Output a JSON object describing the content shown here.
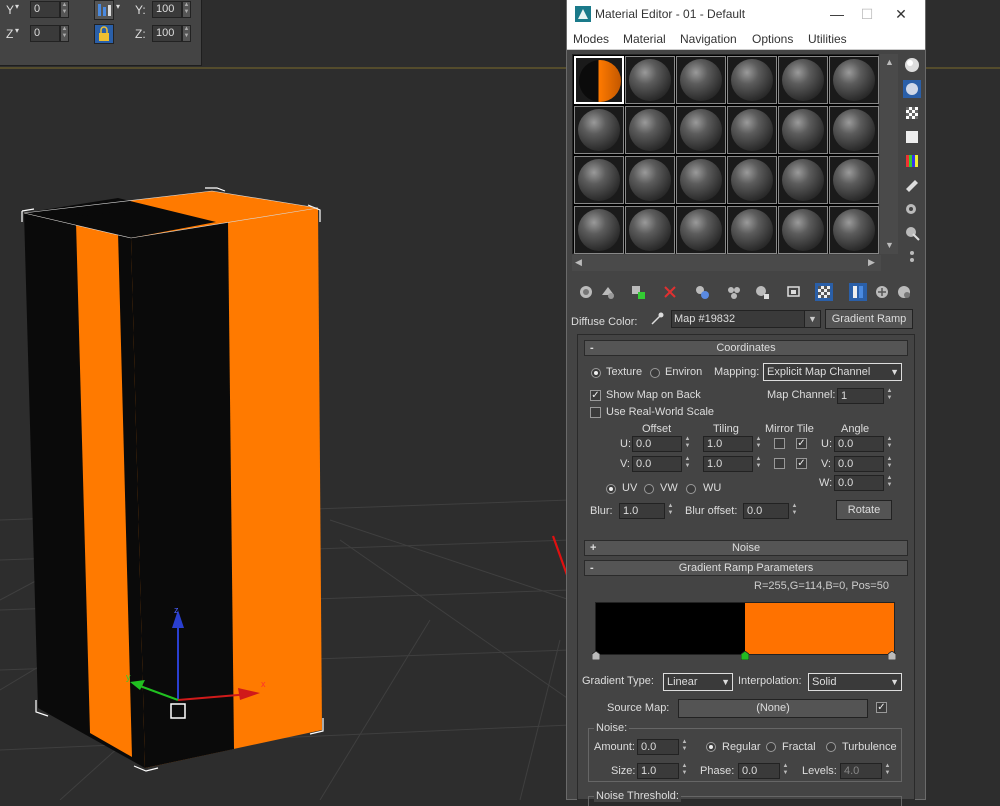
{
  "transform_bar": {
    "y_label": "Y",
    "y_value": "0",
    "z_label": "Z",
    "z_value": "0",
    "scale_y_label": "Y:",
    "scale_y_value": "100",
    "scale_z_label": "Z:",
    "scale_z_value": "100"
  },
  "window": {
    "title": "Material Editor - 01 - Default",
    "icon": "3ds-max-icon",
    "minimize_symbol": "—",
    "maximize_symbol": "☐",
    "close_symbol": "✕"
  },
  "menu": {
    "modes": "Modes",
    "material": "Material",
    "navigation": "Navigation",
    "options": "Options",
    "utilities": "Utilities"
  },
  "slots": {
    "rows": 4,
    "columns": 6,
    "selected_index": 0
  },
  "diffuse": {
    "label": "Diffuse Color:",
    "map_name": "Map #19832",
    "map_type": "Gradient Ramp"
  },
  "coordinates": {
    "header": "Coordinates",
    "collapse_symbol": "-",
    "texture_label": "Texture",
    "environ_label": "Environ",
    "mapping_label": "Mapping:",
    "mapping_value": "Explicit Map Channel",
    "show_map_on_back": "Show Map on Back",
    "map_channel_label": "Map Channel:",
    "map_channel_value": "1",
    "use_real_world": "Use Real-World Scale",
    "offset_label": "Offset",
    "tiling_label": "Tiling",
    "mirror_tile_label": "Mirror Tile",
    "angle_label": "Angle",
    "u_label": "U:",
    "v_label": "V:",
    "w_label": "W:",
    "u_offset": "0.0",
    "v_offset": "0.0",
    "u_tiling": "1.0",
    "v_tiling": "1.0",
    "u_angle": "0.0",
    "v_angle": "0.0",
    "w_angle": "0.0",
    "uv_label": "UV",
    "vw_label": "VW",
    "wu_label": "WU",
    "blur_label": "Blur:",
    "blur_value": "1.0",
    "blur_offset_label": "Blur offset:",
    "blur_offset_value": "0.0",
    "rotate_label": "Rotate"
  },
  "noise_rollout": {
    "header": "Noise",
    "expand_symbol": "+"
  },
  "gradient_ramp": {
    "header": "Gradient Ramp Parameters",
    "collapse_symbol": "-",
    "readout": "R=255,G=114,B=0, Pos=50",
    "ramp_split_fraction": 0.5,
    "left_color": "#000000",
    "right_color": "#ff7200",
    "gradient_type_label": "Gradient Type:",
    "gradient_type_value": "Linear",
    "interpolation_label": "Interpolation:",
    "interpolation_value": "Solid",
    "source_map_label": "Source Map:",
    "source_map_value": "(None)",
    "noise_group_label": "Noise:",
    "amount_label": "Amount:",
    "amount_value": "0.0",
    "regular_label": "Regular",
    "fractal_label": "Fractal",
    "turbulence_label": "Turbulence",
    "size_label": "Size:",
    "size_value": "1.0",
    "phase_label": "Phase:",
    "phase_value": "0.0",
    "levels_label": "Levels:",
    "levels_value": "4.0",
    "noise_threshold_label": "Noise Threshold:"
  },
  "colors": {
    "orange": "#ff7a00",
    "black": "#0a0a0a",
    "selection_blue": "#2a5fa8",
    "annotation_red": "#e01010",
    "flag_green": "#22bb22"
  }
}
